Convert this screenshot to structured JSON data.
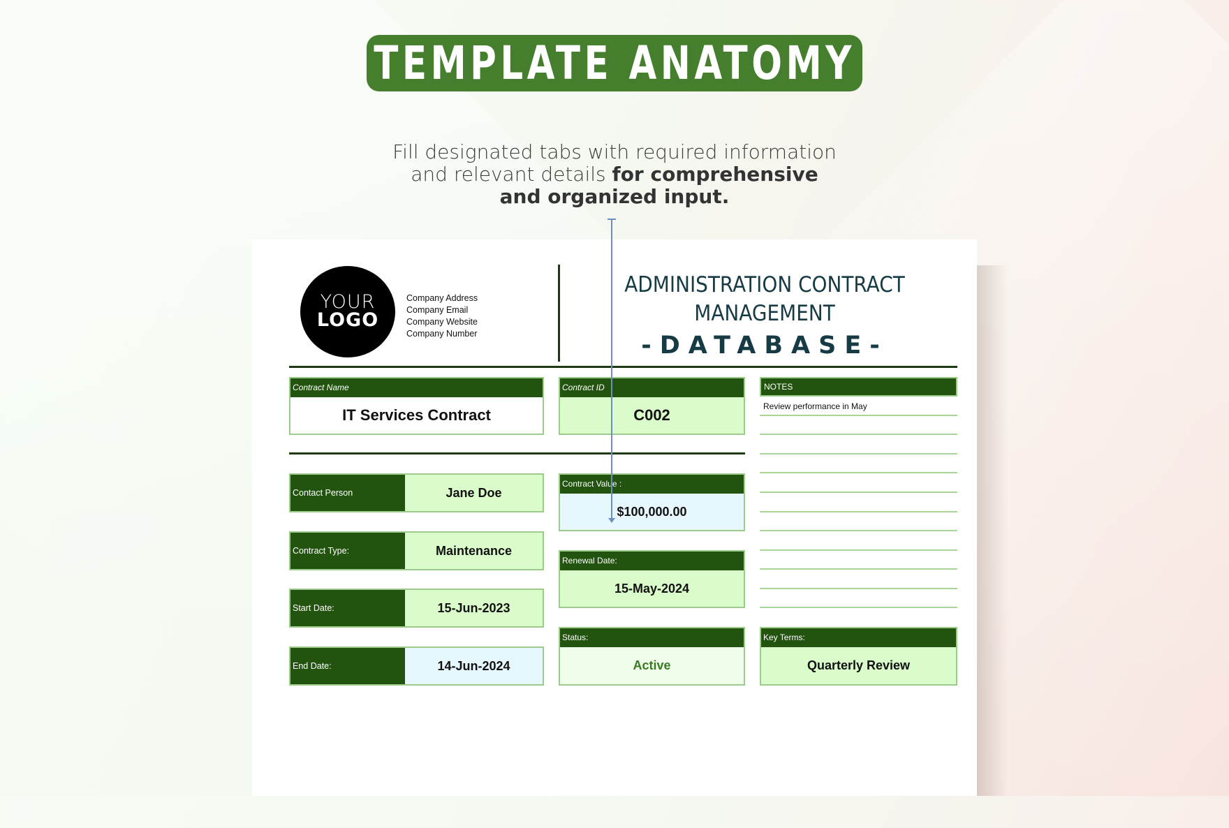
{
  "banner": {
    "title": "TEMPLATE ANATOMY"
  },
  "caption": {
    "regular": "Fill designated tabs with required information and relevant details ",
    "bold": "for comprehensive and organized input."
  },
  "logo": {
    "line1": "YOUR",
    "line2": "LOGO"
  },
  "company": {
    "address": "Company Address",
    "email": "Company Email",
    "website": "Company Website",
    "number": "Company Number"
  },
  "document": {
    "title_line1": "ADMINISTRATION CONTRACT",
    "title_line2": "MANAGEMENT",
    "title_line3": "-DATABASE-"
  },
  "fields": {
    "contract_name": {
      "label": "Contract Name",
      "value": "IT Services Contract"
    },
    "contract_id": {
      "label": "Contract ID",
      "value": "C002"
    },
    "contact_person": {
      "label": "Contact Person",
      "value": "Jane Doe"
    },
    "contract_type": {
      "label": "Contract Type:",
      "value": "Maintenance"
    },
    "start_date": {
      "label": "Start Date:",
      "value": "15-Jun-2023"
    },
    "end_date": {
      "label": "End Date:",
      "value": "14-Jun-2024"
    },
    "contract_value": {
      "label": "Contract Value :",
      "value": "$100,000.00"
    },
    "renewal_date": {
      "label": "Renewal Date:",
      "value": "15-May-2024"
    },
    "status": {
      "label": "Status:",
      "value": "Active",
      "color": "#3a7a22"
    },
    "key_terms": {
      "label": "Key Terms:",
      "value": "Quarterly Review"
    }
  },
  "notes": {
    "label": "NOTES",
    "lines": [
      "Review performance in May",
      "",
      "",
      "",
      "",
      "",
      "",
      "",
      "",
      "",
      ""
    ]
  },
  "colors": {
    "banner": "#457e2c",
    "header_fill": "#22540f",
    "value_green": "#dafcca",
    "value_blue": "#e6f8fd",
    "title_text": "#173b45"
  }
}
